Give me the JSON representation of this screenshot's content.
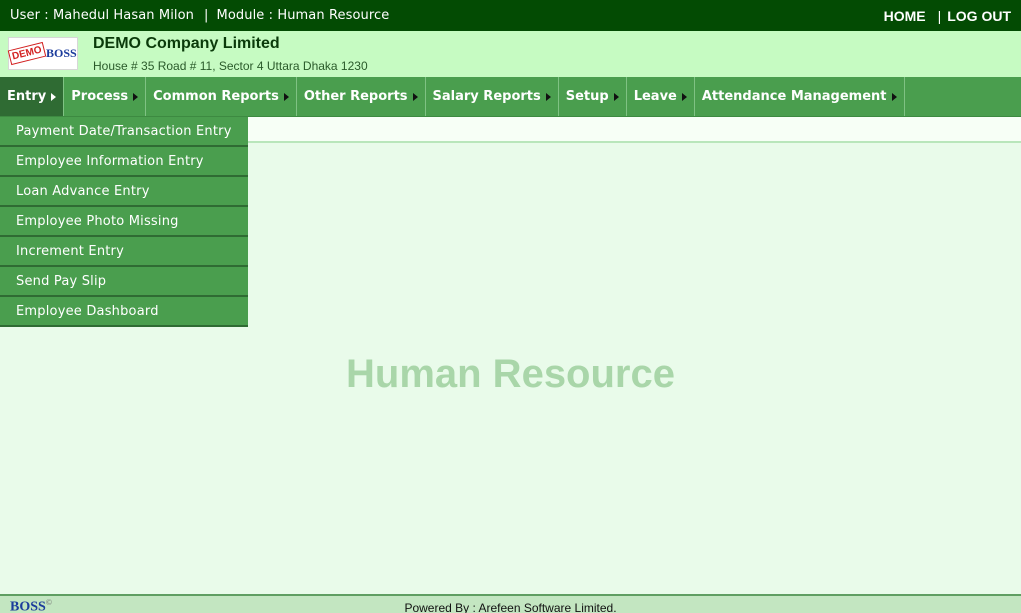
{
  "topbar": {
    "user_text": "User : Mahedul Hasan Milon",
    "separator": "|",
    "module_text": "Module : Human Resource",
    "home_label": "HOME",
    "logout_label": "LOG OUT"
  },
  "header": {
    "logo_demo": "DEMO",
    "logo_brand": "BOSS",
    "company_name": "DEMO Company Limited",
    "company_address": "House # 35 Road # 11, Sector 4 Uttara Dhaka 1230"
  },
  "menu": {
    "items": [
      {
        "label": "Entry",
        "active": true
      },
      {
        "label": "Process"
      },
      {
        "label": "Common Reports"
      },
      {
        "label": "Other Reports"
      },
      {
        "label": "Salary Reports"
      },
      {
        "label": "Setup"
      },
      {
        "label": "Leave"
      },
      {
        "label": "Attendance Management"
      }
    ]
  },
  "dropdown": {
    "items": [
      "Payment Date/Transaction Entry",
      "Employee Information Entry",
      "Loan Advance Entry",
      "Employee Photo Missing",
      "Increment Entry",
      "Send Pay Slip",
      "Employee Dashboard"
    ]
  },
  "main": {
    "watermark": "Human Resource"
  },
  "footer": {
    "logo": "BOSS",
    "logo_mark": "©",
    "powered_by": "Powered By : Arefeen Software Limited."
  },
  "colors": {
    "topbar_bg": "#034b03",
    "header_bg": "#c6fbc2",
    "menu_bg": "#4a9e4e",
    "menu_active_bg": "#2f6b33",
    "page_bg": "#e9fbea",
    "watermark": "#a9d6a9"
  }
}
